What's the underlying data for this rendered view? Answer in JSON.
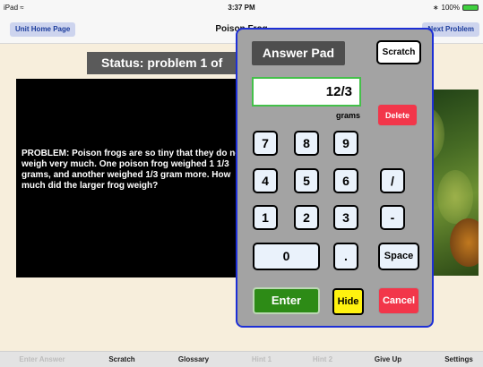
{
  "status_bar": {
    "device": "iPad",
    "wifi_icon": "wifi-icon",
    "time": "3:37 PM",
    "bluetooth_icon": "bluetooth-icon",
    "battery": "100%"
  },
  "nav": {
    "left_button": "Unit Home Page",
    "title": "Poison Frog",
    "right_button": "Next Problem"
  },
  "status": {
    "text": "Status: problem 1 of"
  },
  "problem": {
    "text": "PROBLEM: Poison frogs are so tiny that they do not weigh very much. One poison frog weighed 1 1/3 grams, and another weighed 1/3 gram more. How much did the larger frog weigh?"
  },
  "answer_pad": {
    "title": "Answer Pad",
    "scratch": "Scratch",
    "answer_value": "12/3",
    "units": "grams",
    "delete": "Delete",
    "keys": [
      "7",
      "8",
      "9",
      "4",
      "5",
      "6",
      "/",
      "1",
      "2",
      "3",
      "-",
      "0",
      ".",
      "Space"
    ],
    "enter": "Enter",
    "hide": "Hide",
    "cancel": "Cancel",
    "border_color": "#1d2fd6"
  },
  "toolbar": {
    "items": [
      {
        "label": "Enter Answer",
        "enabled": false
      },
      {
        "label": "Scratch",
        "enabled": true
      },
      {
        "label": "Glossary",
        "enabled": true
      },
      {
        "label": "Hint 1",
        "enabled": false
      },
      {
        "label": "Hint 2",
        "enabled": false
      },
      {
        "label": "Give Up",
        "enabled": true
      },
      {
        "label": "Settings",
        "enabled": true
      }
    ]
  }
}
